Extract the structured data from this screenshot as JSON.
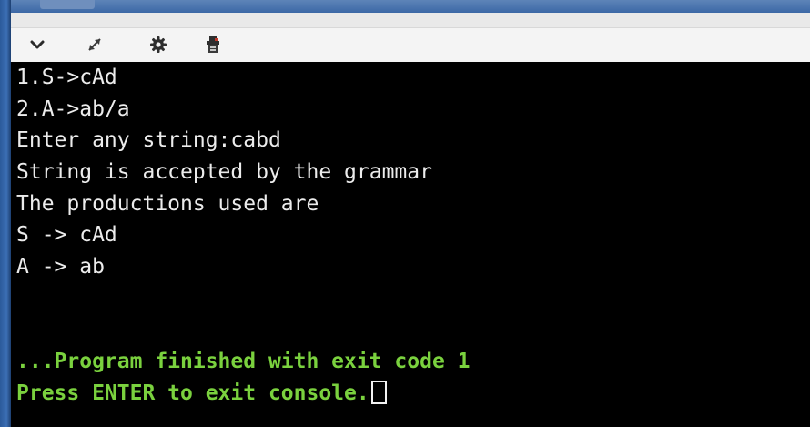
{
  "toolbar": {
    "icons": [
      "chevron-down-icon",
      "expand-icon",
      "gear-icon",
      "stdin-icon"
    ]
  },
  "console": {
    "lines": [
      "1.S->cAd",
      "2.A->ab/a",
      "Enter any string:cabd",
      "String is accepted by the grammar",
      "The productions used are",
      "S -> cAd",
      "A -> ab",
      "",
      "",
      "...Program finished with exit code 1",
      "Press ENTER to exit console."
    ]
  },
  "colors": {
    "background": "#000000",
    "text": "#ececec",
    "status_text": "#7ad13e",
    "toolbar": "#f4f4f4",
    "window_edge": "#3c6fb5"
  }
}
